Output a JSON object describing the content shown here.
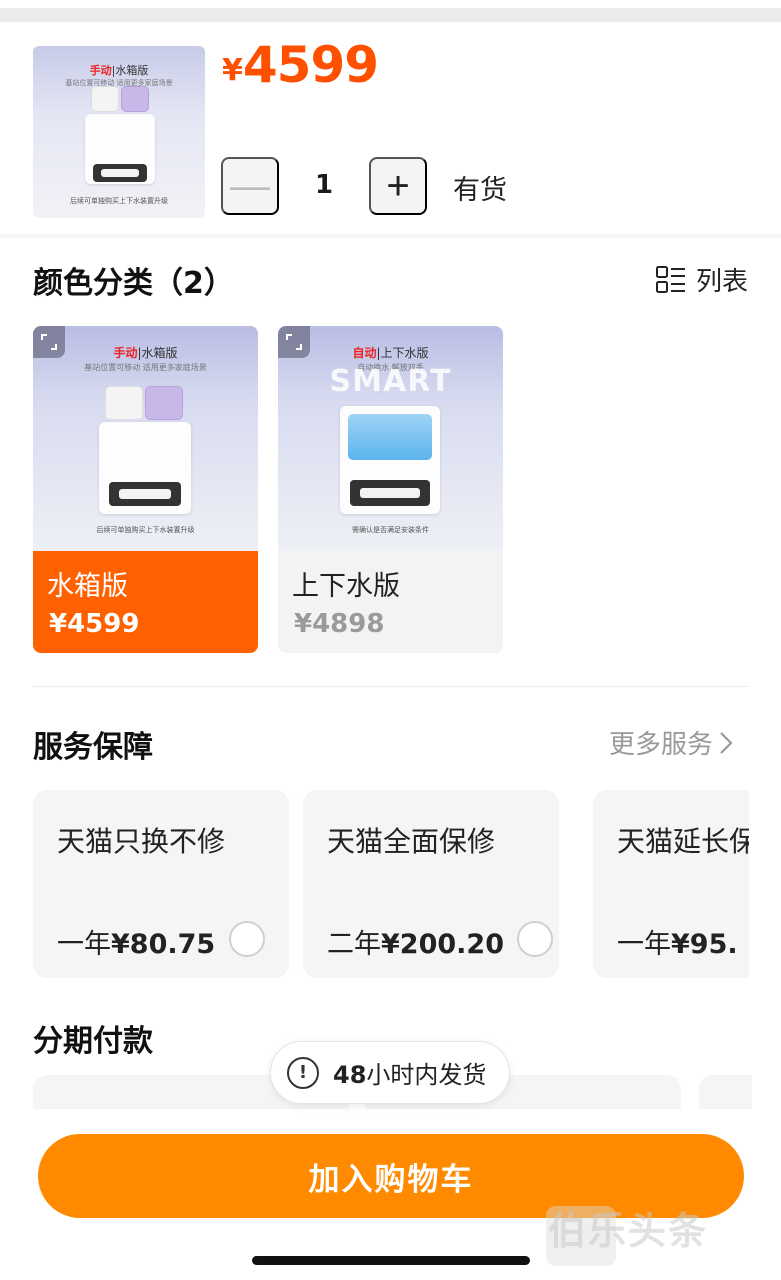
{
  "header": {
    "currency": "¥",
    "price": "4599",
    "quantity": "1",
    "minus_label": "—",
    "plus_label": "+",
    "stock_status": "有货",
    "thumb_tag_red": "手动",
    "thumb_tag_rest": "|水箱版",
    "thumb_sub": "基站位置可移动 适用更多家庭场景",
    "thumb_foot": "后续可单独购买上下水装置升级"
  },
  "variants": {
    "title": "颜色分类（2）",
    "view_toggle_label": "列表",
    "items": [
      {
        "name": "水箱版",
        "price": "¥4599",
        "selected": true,
        "img_tag_red": "手动",
        "img_tag_rest": "|水箱版",
        "img_sub": "基站位置可移动 适用更多家庭场景",
        "img_foot": "后续可单独购买上下水装置升级"
      },
      {
        "name": "上下水版",
        "price": "¥4898",
        "selected": false,
        "img_tag_red": "自动",
        "img_tag_rest": "|上下水版",
        "img_sub": "自动换水 解放双手",
        "img_watermark": "SMART",
        "img_foot": "需确认是否满足安装条件"
      }
    ]
  },
  "services": {
    "title": "服务保障",
    "more_label": "更多服务",
    "items": [
      {
        "name": "天猫只换不修",
        "term": "一年",
        "price": "¥80.75"
      },
      {
        "name": "天猫全面保修",
        "term": "二年",
        "price": "¥200.20"
      },
      {
        "name": "天猫延长保",
        "term": "一年",
        "price": "¥95."
      }
    ]
  },
  "installment": {
    "title": "分期付款"
  },
  "toast": {
    "hours": "48",
    "text": "小时内发货"
  },
  "actions": {
    "add_to_cart_label": "加入购物车"
  },
  "watermark": {
    "text": "伯乐头条"
  },
  "colors": {
    "accent": "#ff5000",
    "selected_card": "#ff6000",
    "cart_button": "#ff8a00"
  }
}
